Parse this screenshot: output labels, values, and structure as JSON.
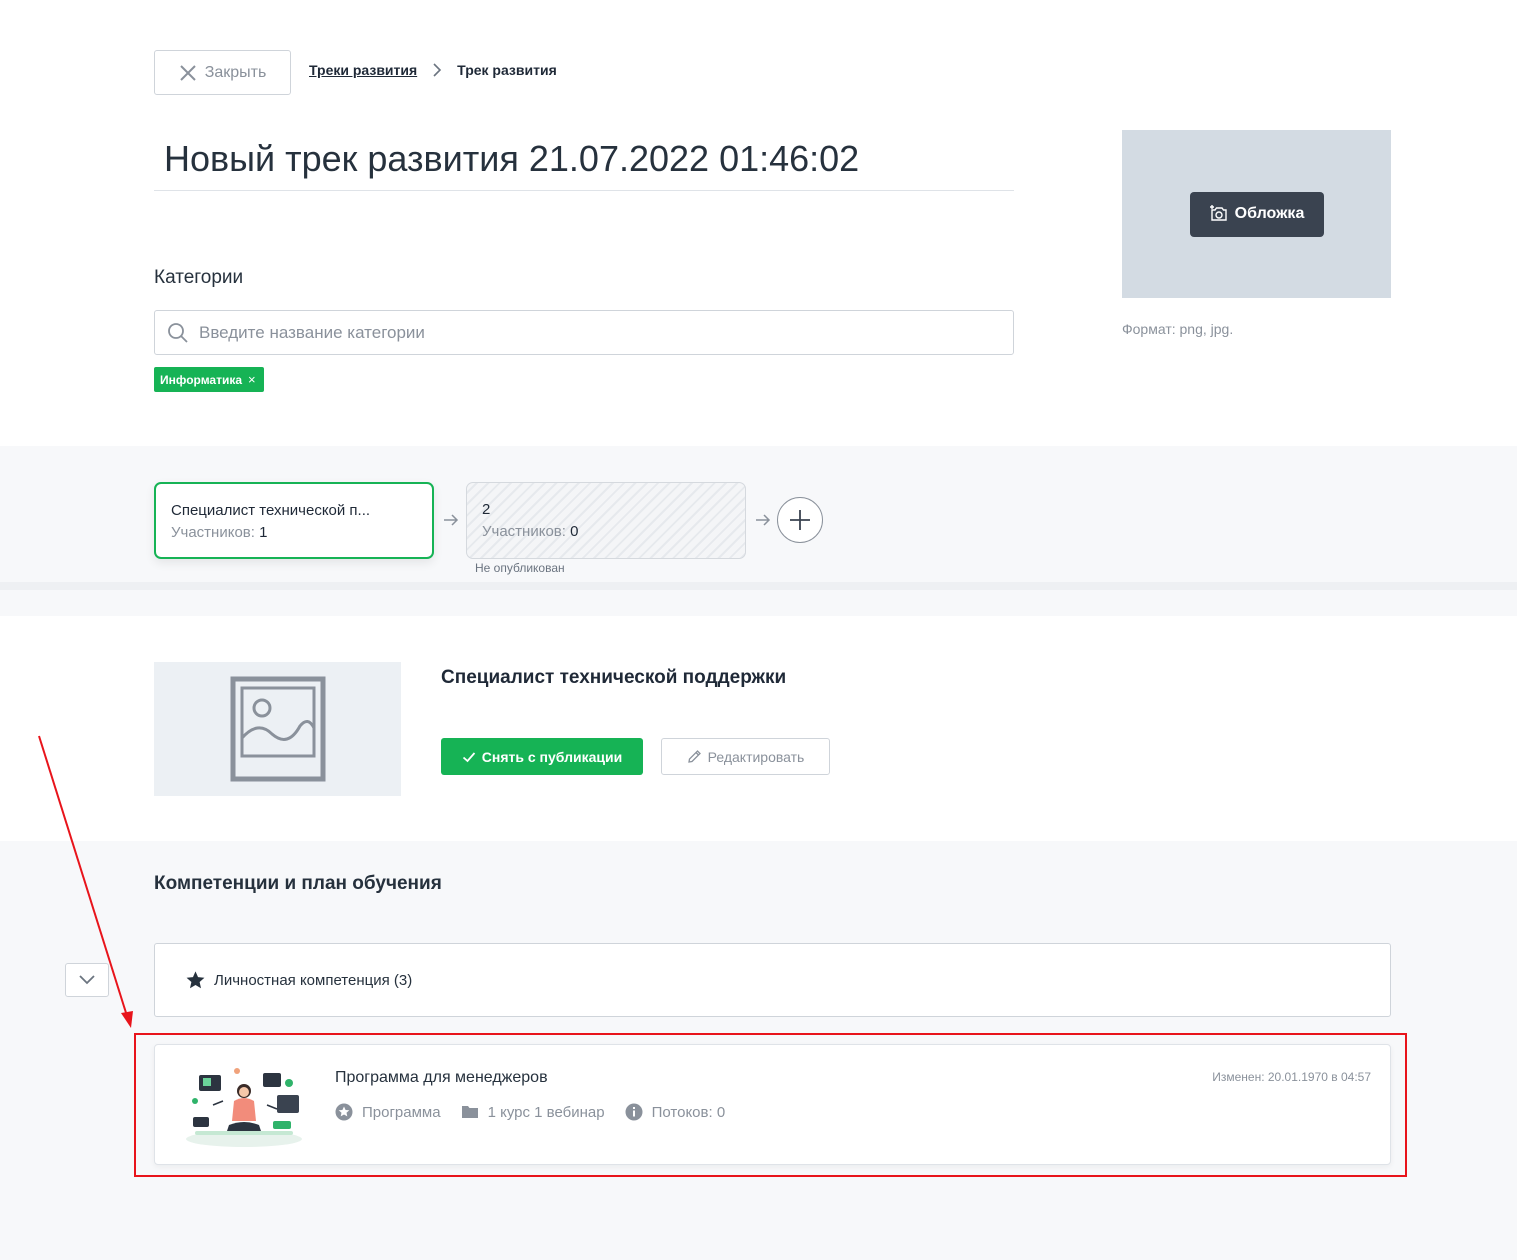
{
  "header": {
    "close_label": "Закрыть",
    "breadcrumb": {
      "parent": "Треки развития",
      "current": "Трек развития"
    }
  },
  "track": {
    "title": "Новый трек развития 21.07.2022 01:46:02",
    "cover_button": "Обложка",
    "cover_format": "Формат: png, jpg."
  },
  "categories": {
    "label": "Категории",
    "search_placeholder": "Введите название категории",
    "tags": [
      "Информатика"
    ]
  },
  "steps": [
    {
      "name": "Специалист технической п...",
      "participants_label": "Участников:",
      "participants": "1",
      "status": ""
    },
    {
      "name": "2",
      "participants_label": "Участников:",
      "participants": "0",
      "status": "Не опубликован"
    }
  ],
  "selected_step": {
    "title": "Специалист технической поддержки",
    "unpublish_label": "Снять с публикации",
    "edit_label": "Редактировать"
  },
  "competencies": {
    "title": "Компетенции и план обучения",
    "group_label": "Личностная компетенция (3)",
    "program": {
      "name": "Программа для менеджеров",
      "type": "Программа",
      "contents": "1 курс 1 вебинар",
      "streams": "Потоков: 0",
      "changed": "Изменен: 20.01.1970 в 04:57"
    }
  },
  "colors": {
    "accent_green": "#16b355",
    "annotation_red": "#e8141b",
    "dark_button": "#3a4350"
  }
}
